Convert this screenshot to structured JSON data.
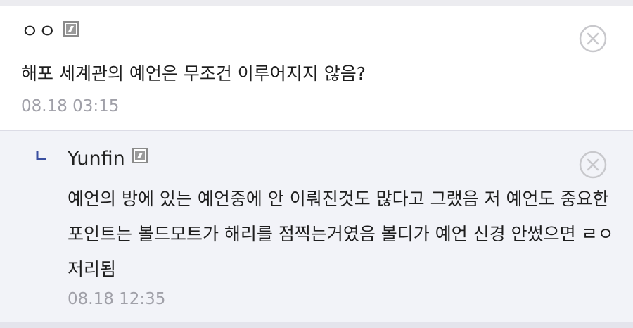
{
  "comments": [
    {
      "author": "ㅇㅇ",
      "text": "해포 세계관의 예언은 무조건 이루어지지 않음?",
      "timestamp": "08.18 03:15",
      "icons": {
        "level": "level-badge-icon",
        "delete": "close-circle-icon"
      }
    }
  ],
  "replies": [
    {
      "author": "Yunfin",
      "text": "예언의 방에 있는 예언중에 안 이뤄진것도 많다고 그랬음 저 예언도 중요한 포인트는 볼드모트가 해리를 점찍는거였음 볼디가 예언 신경 안썼으면 ㄹㅇ 저리됨",
      "timestamp": "08.18 12:35",
      "icons": {
        "reply": "reply-arrow-icon",
        "level": "level-badge-icon",
        "delete": "close-circle-icon"
      }
    }
  ],
  "colors": {
    "reply_background": "#f2f3f8",
    "timestamp": "#a0a0a8",
    "reply_arrow": "#3a4fa0"
  }
}
